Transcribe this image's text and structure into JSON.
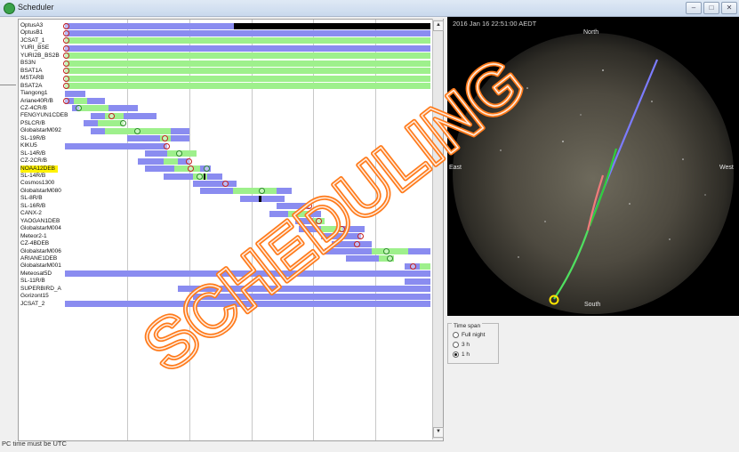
{
  "window": {
    "title": "Scheduler",
    "buttons": [
      "–",
      "□",
      "✕"
    ]
  },
  "status_text": "PC time must be UTC",
  "sky": {
    "timestamp": "2016 Jan 16  22:51:00 AEDT",
    "north": "North",
    "south": "South",
    "east": "East",
    "west": "West"
  },
  "time_span": {
    "label": "Time span",
    "options": [
      "Full night",
      "3 h",
      "1 h"
    ],
    "selected": "1 h"
  },
  "watermark": "SCHEDULING",
  "satellites": [
    {
      "name": "OptusA3",
      "bars": [
        [
          "blue",
          0,
          0.463
        ],
        [
          "black",
          0.463,
          1.0
        ]
      ],
      "markers": [
        [
          0.0,
          "r"
        ]
      ]
    },
    {
      "name": "OptusB1",
      "bars": [
        [
          "blue",
          0,
          1.0
        ]
      ],
      "markers": [
        [
          0.0,
          "r"
        ]
      ]
    },
    {
      "name": "JCSAT_1",
      "bars": [
        [
          "green",
          0,
          1.0
        ]
      ],
      "markers": [
        [
          0.0,
          "r"
        ]
      ]
    },
    {
      "name": "YURI_BSE",
      "bars": [
        [
          "blue",
          0,
          1.0
        ]
      ],
      "markers": [
        [
          0.0,
          "r"
        ]
      ]
    },
    {
      "name": "YURI2B_BS2B",
      "bars": [
        [
          "green",
          0,
          1.0
        ]
      ],
      "markers": [
        [
          0.0,
          "r"
        ]
      ]
    },
    {
      "name": "BS3N",
      "bars": [
        [
          "green",
          0,
          1.0
        ]
      ],
      "markers": [
        [
          0.0,
          "r"
        ]
      ]
    },
    {
      "name": "BSAT1A",
      "bars": [
        [
          "green",
          0,
          1.0
        ]
      ],
      "markers": [
        [
          0.0,
          "r"
        ]
      ]
    },
    {
      "name": "MSTARB",
      "bars": [
        [
          "green",
          0,
          1.0
        ]
      ],
      "markers": [
        [
          0.0,
          "r"
        ]
      ]
    },
    {
      "name": "BSAT2A",
      "bars": [
        [
          "green",
          0,
          1.0
        ]
      ],
      "markers": [
        [
          0.0,
          "r"
        ]
      ]
    },
    {
      "name": "Tiangong1",
      "bars": [
        [
          "blue",
          0,
          0.055
        ]
      ],
      "markers": []
    },
    {
      "name": "Ariane40R/B",
      "bars": [
        [
          "blue",
          0,
          0.025
        ],
        [
          "green",
          0.025,
          0.06
        ],
        [
          "blue",
          0.06,
          0.11
        ]
      ],
      "markers": [
        [
          0.0,
          "r"
        ]
      ]
    },
    {
      "name": "CZ-4CR/B",
      "bars": [
        [
          "blue",
          0.02,
          0.04
        ],
        [
          "green",
          0.04,
          0.12
        ],
        [
          "blue",
          0.12,
          0.2
        ]
      ],
      "markers": [
        [
          0.035,
          "g"
        ]
      ]
    },
    {
      "name": "FENGYUN1CDEB",
      "bars": [
        [
          "blue",
          0.07,
          0.11
        ],
        [
          "green",
          0.11,
          0.16
        ],
        [
          "blue",
          0.16,
          0.25
        ]
      ],
      "markers": [
        [
          0.125,
          "r"
        ]
      ]
    },
    {
      "name": "PSLCR/B",
      "bars": [
        [
          "blue",
          0.05,
          0.09
        ],
        [
          "green",
          0.09,
          0.16
        ]
      ],
      "markers": [
        [
          0.155,
          "g"
        ]
      ]
    },
    {
      "name": "GlobalstarM092",
      "bars": [
        [
          "blue",
          0.07,
          0.11
        ],
        [
          "green",
          0.11,
          0.29
        ],
        [
          "blue",
          0.29,
          0.34
        ]
      ],
      "markers": [
        [
          0.195,
          "g"
        ]
      ]
    },
    {
      "name": "SL-19R/B",
      "bars": [
        [
          "blue",
          0.17,
          0.26
        ],
        [
          "green",
          0.26,
          0.29
        ],
        [
          "blue",
          0.29,
          0.34
        ]
      ],
      "markers": [
        [
          0.27,
          "r"
        ]
      ]
    },
    {
      "name": "KIKU5",
      "bars": [
        [
          "blue",
          0,
          0.28
        ]
      ],
      "markers": [
        [
          0.275,
          "r"
        ]
      ]
    },
    {
      "name": "SL-14R/B",
      "bars": [
        [
          "blue",
          0.22,
          0.28
        ],
        [
          "green",
          0.28,
          0.36
        ]
      ],
      "markers": [
        [
          0.31,
          "g"
        ]
      ]
    },
    {
      "name": "CZ-2CR/B",
      "bars": [
        [
          "blue",
          0.2,
          0.27
        ],
        [
          "green",
          0.27,
          0.31
        ],
        [
          "blue",
          0.31,
          0.34
        ]
      ],
      "markers": [
        [
          0.335,
          "r"
        ]
      ]
    },
    {
      "name": "NOAA12DEB",
      "bars": [
        [
          "blue",
          0.22,
          0.3
        ],
        [
          "green",
          0.3,
          0.37
        ],
        [
          "blue",
          0.37,
          0.4
        ]
      ],
      "markers": [
        [
          0.34,
          "r"
        ],
        [
          0.385,
          "g"
        ]
      ]
    },
    {
      "name": "SL-14R/B",
      "bars": [
        [
          "blue",
          0.27,
          0.35
        ],
        [
          "green",
          0.35,
          0.39
        ],
        [
          "black",
          0.38,
          0.385
        ],
        [
          "blue",
          0.39,
          0.43
        ]
      ],
      "markers": [
        [
          0.365,
          "g"
        ]
      ]
    },
    {
      "name": "Cosmos1300",
      "bars": [
        [
          "blue",
          0.35,
          0.47
        ]
      ],
      "markers": [
        [
          0.435,
          "r"
        ]
      ]
    },
    {
      "name": "GlobalstarM080",
      "bars": [
        [
          "blue",
          0.37,
          0.46
        ],
        [
          "green",
          0.46,
          0.58
        ],
        [
          "blue",
          0.58,
          0.62
        ]
      ],
      "markers": [
        [
          0.535,
          "g"
        ]
      ]
    },
    {
      "name": "SL-8R/B",
      "bars": [
        [
          "blue",
          0.48,
          0.53
        ],
        [
          "black",
          0.53,
          0.537
        ],
        [
          "blue",
          0.537,
          0.6
        ]
      ],
      "markers": []
    },
    {
      "name": "SL-16R/B",
      "bars": [
        [
          "blue",
          0.58,
          0.67
        ]
      ],
      "markers": [
        [
          0.665,
          "r"
        ]
      ]
    },
    {
      "name": "CANX-2",
      "bars": [
        [
          "blue",
          0.56,
          0.61
        ],
        [
          "green",
          0.61,
          0.67
        ],
        [
          "blue",
          0.67,
          0.7
        ]
      ],
      "markers": []
    },
    {
      "name": "YAOGAN1DEB",
      "bars": [
        [
          "blue",
          0.63,
          0.68
        ],
        [
          "green",
          0.68,
          0.71
        ]
      ],
      "markers": [
        [
          0.69,
          "r"
        ]
      ]
    },
    {
      "name": "GlobalstarM004",
      "bars": [
        [
          "blue",
          0.64,
          0.7
        ],
        [
          "green",
          0.7,
          0.76
        ],
        [
          "blue",
          0.76,
          0.82
        ]
      ],
      "markers": [
        [
          0.755,
          "r"
        ]
      ]
    },
    {
      "name": "Meteor2-1",
      "bars": [
        [
          "blue",
          0.7,
          0.81
        ]
      ],
      "markers": [
        [
          0.805,
          "r"
        ]
      ]
    },
    {
      "name": "CZ-4BDEB",
      "bars": [
        [
          "blue",
          0.73,
          0.84
        ]
      ],
      "markers": [
        [
          0.795,
          "r"
        ]
      ]
    },
    {
      "name": "GlobalstarM006",
      "bars": [
        [
          "blue",
          0.71,
          0.84
        ],
        [
          "green",
          0.84,
          0.94
        ],
        [
          "blue",
          0.94,
          1.0
        ]
      ],
      "markers": [
        [
          0.875,
          "g"
        ]
      ]
    },
    {
      "name": "ARIANE1DEB",
      "bars": [
        [
          "blue",
          0.77,
          0.86
        ],
        [
          "green",
          0.86,
          0.9
        ]
      ],
      "markers": [
        [
          0.885,
          "g"
        ]
      ]
    },
    {
      "name": "GlobalstarM001",
      "bars": [
        [
          "blue",
          0.93,
          0.97
        ],
        [
          "green",
          0.97,
          1.0
        ]
      ],
      "markers": [
        [
          0.95,
          "r"
        ]
      ]
    },
    {
      "name": "Meteosat5D",
      "bars": [
        [
          "blue",
          0,
          1.0
        ]
      ],
      "markers": []
    },
    {
      "name": "SL-11R/B",
      "bars": [
        [
          "blue",
          0.93,
          1.0
        ]
      ],
      "markers": []
    },
    {
      "name": "SUPERBIRD_A",
      "bars": [
        [
          "blue",
          0.31,
          1.0
        ]
      ],
      "markers": []
    },
    {
      "name": "Gorizont15",
      "bars": [
        [
          "blue",
          0.35,
          1.0
        ]
      ],
      "markers": []
    },
    {
      "name": "JCSAT_2",
      "bars": [
        [
          "blue",
          0,
          1.0
        ]
      ],
      "markers": []
    }
  ],
  "highlighted": "NOAA12DEB"
}
